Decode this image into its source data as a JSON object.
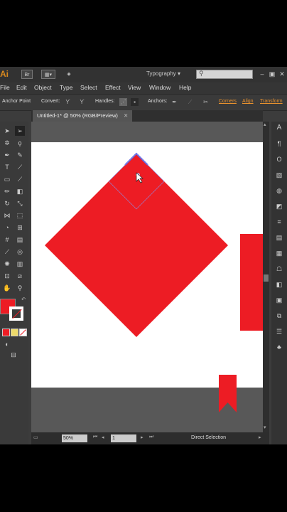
{
  "app": {
    "logo": "Ai",
    "bridge_label": "Br",
    "workspace": "Typography",
    "search_placeholder": "",
    "window_controls": [
      "minimize-icon",
      "restore-icon",
      "close-icon"
    ]
  },
  "menu": {
    "items": [
      "File",
      "Edit",
      "Object",
      "Type",
      "Select",
      "Effect",
      "View",
      "Window",
      "Help"
    ]
  },
  "control_bar": {
    "anchor_point": "Anchor Point",
    "convert": "Convert:",
    "handles": "Handles:",
    "anchors": "Anchors:",
    "links": [
      "Corners",
      "Align",
      "Transform"
    ]
  },
  "document": {
    "tab_title": "Untitled-1* @ 50% (RGB/Preview)"
  },
  "status": {
    "zoom": "50%",
    "page": "1",
    "tool_name": "Direct Selection"
  },
  "colors": {
    "shape_red": "#ed1c24",
    "accent_orange": "#e8912e",
    "path_highlight": "#5a60e0"
  },
  "tools": [
    "selection-tool",
    "direct-selection-tool",
    "magic-wand-tool",
    "lasso-tool",
    "pen-tool",
    "curvature-tool",
    "type-tool",
    "line-tool",
    "rectangle-tool",
    "paintbrush-tool",
    "pencil-tool",
    "eraser-tool",
    "rotate-tool",
    "scale-tool",
    "width-tool",
    "free-transform-tool",
    "shape-builder-tool",
    "perspective-tool",
    "mesh-tool",
    "gradient-tool",
    "eyedropper-tool",
    "blend-tool",
    "symbol-sprayer-tool",
    "column-graph-tool",
    "artboard-tool",
    "slice-tool",
    "hand-tool",
    "zoom-tool"
  ]
}
